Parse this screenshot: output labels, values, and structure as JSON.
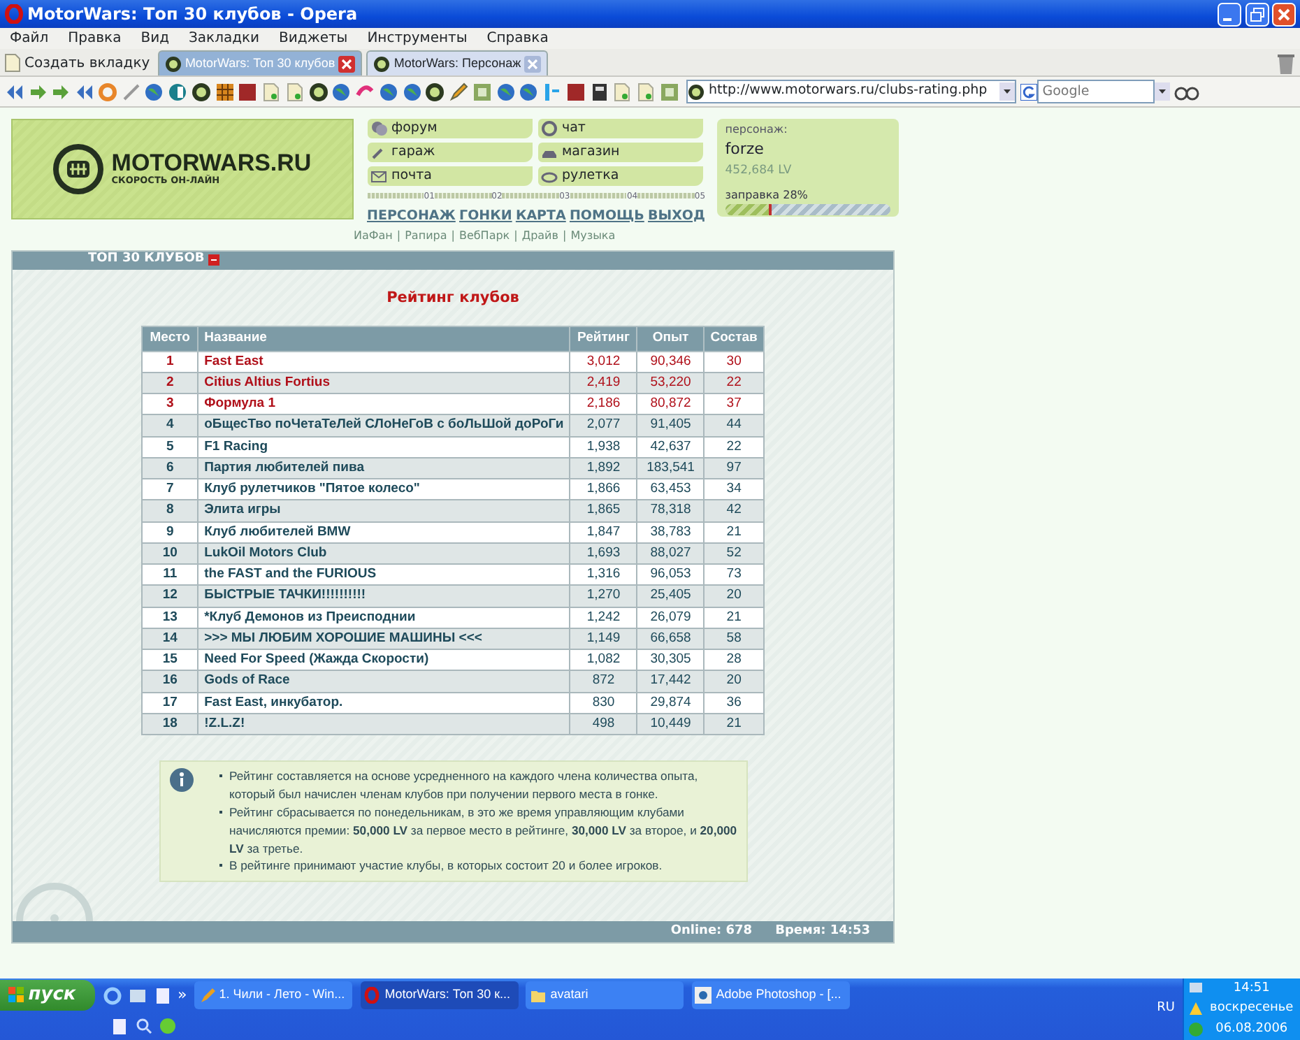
{
  "window": {
    "title": "MotorWars: Топ 30 клубов - Opera"
  },
  "menu": [
    "Файл",
    "Правка",
    "Вид",
    "Закладки",
    "Виджеты",
    "Инструменты",
    "Справка"
  ],
  "new_tab": "Создать вкладку",
  "tabs": [
    {
      "label": "MotorWars: Топ 30 клубов",
      "selected": true
    },
    {
      "label": "MotorWars: Персонаж",
      "selected": false
    }
  ],
  "address_bar": {
    "value": "http://www.motorwars.ru/clubs-rating.php"
  },
  "search": {
    "placeholder": "Google"
  },
  "site": {
    "logo": {
      "name": "MOTORWARS.RU",
      "tagline": "СКОРОСТЬ ОН-ЛАЙН"
    },
    "quick_links": [
      "форум",
      "чат",
      "гараж",
      "магазин",
      "почта",
      "рулетка"
    ],
    "scale": [
      "01",
      "02",
      "03",
      "04",
      "05"
    ],
    "nav": [
      "ПЕРСОНАЖ",
      "ГОНКИ",
      "КАРТА",
      "ПОМОЩЬ",
      "ВЫХОД"
    ],
    "sublinks": [
      {
        "label": "ИаФан"
      },
      {
        "separator": "|",
        "label": "Рапира"
      },
      {
        "separator": "|",
        "label": "ВебПарк"
      },
      {
        "separator": "|",
        "label": "Драйв"
      },
      {
        "separator": "|",
        "label": "Музыка"
      }
    ],
    "player": {
      "label": "персонаж:",
      "name": "forze",
      "money": "452,684 LV",
      "fuel_label": "заправка 28%",
      "level": 0.28
    }
  },
  "panel": {
    "title": "ТОП 30 КЛУБОВ",
    "heading": "Рейтинг клубов",
    "columns": [
      "Место",
      "Название",
      "Рейтинг",
      "Опыт",
      "Состав"
    ],
    "rows": [
      {
        "cells": [
          "1",
          "Fast East",
          "3,012",
          "90,346",
          "30"
        ],
        "top": true
      },
      {
        "cells": [
          "2",
          "Citius Altius Fortius",
          "2,419",
          "53,220",
          "22"
        ],
        "top": true
      },
      {
        "cells": [
          "3",
          "Формула 1",
          "2,186",
          "80,872",
          "37"
        ],
        "top": true
      },
      {
        "cells": [
          "4",
          "оБщесТво поЧетаТеЛей СЛоНеГоВ с боЛьШой доРоГи",
          "2,077",
          "91,405",
          "44"
        ],
        "top": false
      },
      {
        "cells": [
          "5",
          "F1 Racing",
          "1,938",
          "42,637",
          "22"
        ],
        "top": false
      },
      {
        "cells": [
          "6",
          "Партия любителей пива",
          "1,892",
          "183,541",
          "97"
        ],
        "top": false
      },
      {
        "cells": [
          "7",
          "Клуб рулетчиков \"Пятое колесо\"",
          "1,866",
          "63,453",
          "34"
        ],
        "top": false
      },
      {
        "cells": [
          "8",
          "Элита игры",
          "1,865",
          "78,318",
          "42"
        ],
        "top": false
      },
      {
        "cells": [
          "9",
          "Клуб любителей BMW",
          "1,847",
          "38,783",
          "21"
        ],
        "top": false
      },
      {
        "cells": [
          "10",
          "LukOil Motors Club",
          "1,693",
          "88,027",
          "52"
        ],
        "top": false
      },
      {
        "cells": [
          "11",
          "the FAST and the FURIOUS",
          "1,316",
          "96,053",
          "73"
        ],
        "top": false
      },
      {
        "cells": [
          "12",
          "БЫСТРЫЕ ТАЧКИ!!!!!!!!!!",
          "1,270",
          "25,405",
          "20"
        ],
        "top": false
      },
      {
        "cells": [
          "13",
          "*Клуб Демонов из Преисподнии",
          "1,242",
          "26,079",
          "21"
        ],
        "top": false
      },
      {
        "cells": [
          "14",
          ">>> МЫ ЛЮБИМ ХОРОШИЕ МАШИНЫ <<<",
          "1,149",
          "66,658",
          "58"
        ],
        "top": false
      },
      {
        "cells": [
          "15",
          "Need For Speed (Жажда Скорости)",
          "1,082",
          "30,305",
          "28"
        ],
        "top": false
      },
      {
        "cells": [
          "16",
          "Gods of Race",
          "872",
          "17,442",
          "20"
        ],
        "top": false
      },
      {
        "cells": [
          "17",
          "Fast East, инкубатор.",
          "830",
          "29,874",
          "36"
        ],
        "top": false
      },
      {
        "cells": [
          "18",
          "!Z.L.Z!",
          "498",
          "10,449",
          "21"
        ],
        "top": false
      }
    ],
    "notes": [
      "Рейтинг составляется на основе усредненного на каждого члена количества опыта, который был начислен членам клубов при получении первого места в гонке.",
      "Рейтинг сбрасывается по понедельникам, в это же время управляющим клубами начисляются премии: **50,000 LV** за первое место в рейтинге, **30,000 LV** за второе, и **20,000 LV** за третье.",
      "В рейтинге принимают участие клубы, в которых состоит 20 и более игроков."
    ],
    "online": "Online: 678",
    "time": "Время: 14:53"
  },
  "taskbar": {
    "start": "пуск",
    "overflow": "»",
    "tasks": [
      {
        "label": "1. Чили - Лето - Win...",
        "selected": false
      },
      {
        "label": "MotorWars: Топ 30 к...",
        "selected": true
      },
      {
        "label": "avatari",
        "selected": false
      },
      {
        "label": "Adobe Photoshop - [...",
        "selected": false
      }
    ],
    "lang": "RU",
    "clock": {
      "time": "14:51",
      "day": "воскресенье",
      "date": "06.08.2006"
    }
  }
}
